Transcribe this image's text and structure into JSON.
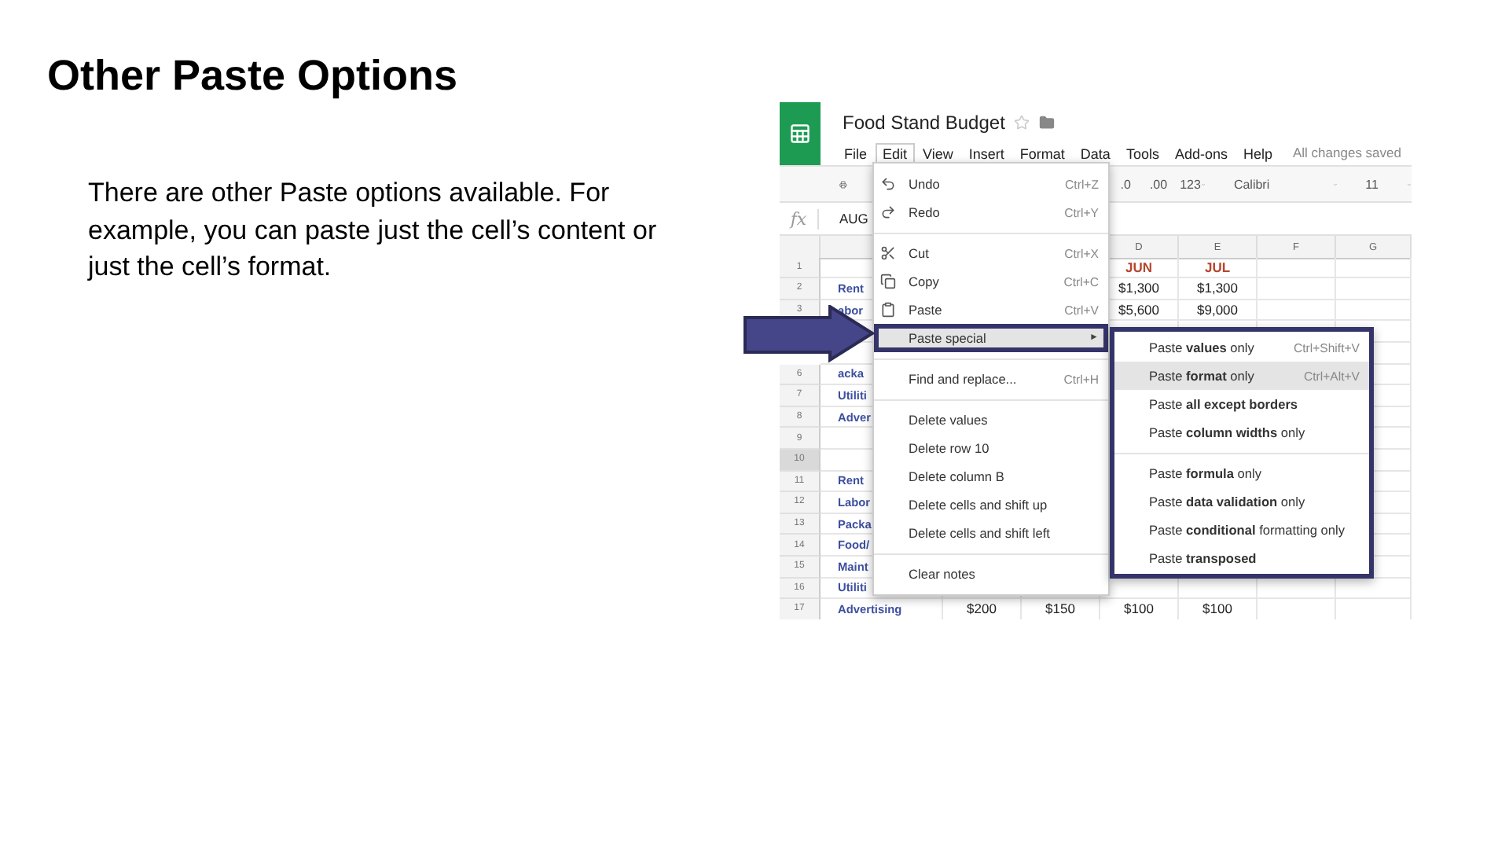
{
  "slide": {
    "title": "Other Paste Options",
    "body": "There are other Paste options available. For example, you can paste just the cell’s content or just the cell’s format."
  },
  "app": {
    "doc_title": "Food Stand Budget",
    "menu": [
      {
        "label": "File",
        "selected": false
      },
      {
        "label": "Edit",
        "selected": true
      },
      {
        "label": "View",
        "selected": false
      },
      {
        "label": "Insert",
        "selected": false
      },
      {
        "label": "Format",
        "selected": false
      },
      {
        "label": "Data",
        "selected": false
      },
      {
        "label": "Tools",
        "selected": false
      },
      {
        "label": "Add-ons",
        "selected": false
      },
      {
        "label": "Help",
        "selected": false
      }
    ],
    "save_status": "All changes saved",
    "toolbar": {
      "decrease_decimal": ".0",
      "increase_decimal": ".00",
      "number_format": "123",
      "font": "Calibri",
      "font_size": "11"
    },
    "formula_bar": {
      "label": "fx",
      "value": "AUG"
    },
    "columns": [
      "D",
      "E",
      "F",
      "G"
    ],
    "rows": [
      {
        "number": "1",
        "kind": "heading",
        "selected": false,
        "d": "JUN",
        "e": "JUL"
      },
      {
        "number": "2",
        "kind": "item",
        "selected": false,
        "label": "Rent",
        "d": "$1,300",
        "e": "$1,300"
      },
      {
        "number": "3",
        "kind": "item",
        "selected": false,
        "label": "abor",
        "d": "$5,600",
        "e": "$9,000"
      },
      {
        "kind": "item"
      },
      {
        "kind": "item"
      },
      {
        "number": "6",
        "kind": "item",
        "selected": false,
        "label": "acka"
      },
      {
        "number": "7",
        "kind": "item",
        "selected": false,
        "label": "Utiliti"
      },
      {
        "number": "8",
        "kind": "item",
        "selected": false,
        "label": "Adver"
      },
      {
        "number": "9",
        "kind": "item",
        "selected": false
      },
      {
        "number": "10",
        "kind": "item",
        "selected": true
      },
      {
        "number": "11",
        "kind": "item",
        "selected": false,
        "label": "Rent"
      },
      {
        "number": "12",
        "kind": "item",
        "selected": false,
        "label": "Labor"
      },
      {
        "number": "13",
        "kind": "item",
        "selected": false,
        "label": "Packa"
      },
      {
        "number": "14",
        "kind": "item",
        "selected": false,
        "label": "Food/"
      },
      {
        "number": "15",
        "kind": "item",
        "selected": false,
        "label": "Maint"
      },
      {
        "number": "16",
        "kind": "item",
        "selected": false,
        "label": "Utiliti"
      },
      {
        "number": "17",
        "kind": "item",
        "selected": false,
        "label": "Advertising",
        "b": "$200",
        "c": "$150",
        "d": "$100",
        "e": "$100"
      }
    ],
    "edit_menu": [
      {
        "kind": "item",
        "label": "Undo",
        "shortcut": "Ctrl+Z",
        "selected": false
      },
      {
        "kind": "item",
        "label": "Redo",
        "shortcut": "Ctrl+Y",
        "selected": false
      },
      {
        "kind": "separator"
      },
      {
        "kind": "item",
        "label": "Cut",
        "shortcut": "Ctrl+X",
        "selected": false
      },
      {
        "kind": "item",
        "label": "Copy",
        "shortcut": "Ctrl+C",
        "selected": false
      },
      {
        "kind": "item",
        "label": "Paste",
        "shortcut": "Ctrl+V",
        "selected": false
      },
      {
        "kind": "item",
        "label": "Paste special",
        "submenu_arrow": "►",
        "selected": true
      },
      {
        "kind": "separator"
      },
      {
        "kind": "item",
        "label": "Find and replace...",
        "shortcut": "Ctrl+H",
        "selected": false
      },
      {
        "kind": "separator"
      },
      {
        "kind": "item",
        "label": "Delete values",
        "selected": false
      },
      {
        "kind": "item",
        "label": "Delete row 10",
        "selected": false
      },
      {
        "kind": "item",
        "label": "Delete column B",
        "selected": false
      },
      {
        "kind": "item",
        "label": "Delete cells and shift up",
        "selected": false
      },
      {
        "kind": "item",
        "label": "Delete cells and shift left",
        "selected": false
      },
      {
        "kind": "separator"
      },
      {
        "kind": "item",
        "label": "Clear notes",
        "selected": false
      }
    ],
    "paste_special_menu": [
      {
        "kind": "item",
        "label": "Paste **values** only",
        "shortcut": "Ctrl+Shift+V",
        "selected": false
      },
      {
        "kind": "item",
        "label": "Paste **format** only",
        "shortcut": "Ctrl+Alt+V",
        "selected": true
      },
      {
        "kind": "item",
        "label": "Paste **all except borders**",
        "selected": false
      },
      {
        "kind": "item",
        "label": "Paste **column widths** only",
        "selected": false
      },
      {
        "kind": "separator"
      },
      {
        "kind": "item",
        "label": "Paste **formula** only",
        "selected": false
      },
      {
        "kind": "item",
        "label": "Paste **data validation** only",
        "selected": false
      },
      {
        "kind": "item",
        "label": "Paste **conditional** formatting only",
        "selected": false
      },
      {
        "kind": "item",
        "label": "Paste **transposed**",
        "selected": false
      }
    ]
  }
}
